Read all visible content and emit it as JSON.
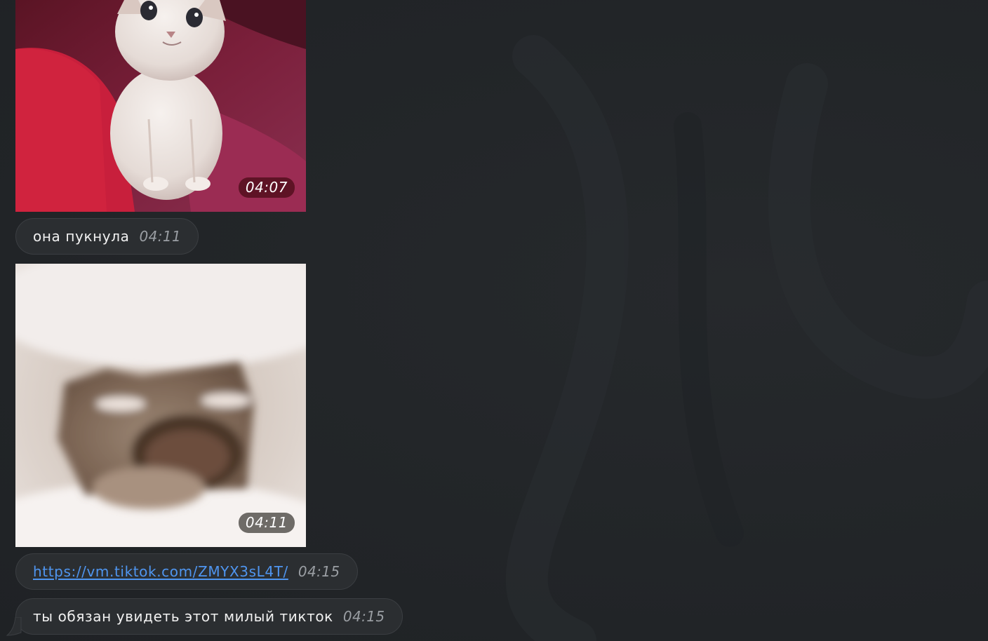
{
  "messages": [
    {
      "kind": "photo",
      "subject": "kitten",
      "time": "04:07"
    },
    {
      "kind": "text",
      "text": "она пукнула",
      "time": "04:11"
    },
    {
      "kind": "photo",
      "subject": "crying-cat-meme",
      "time": "04:11"
    },
    {
      "kind": "link",
      "text": "https://vm.tiktok.com/ZMYX3sL4T/",
      "time": "04:15"
    },
    {
      "kind": "text",
      "text": "ты обязан увидеть этот милый тикток",
      "time": "04:15"
    }
  ],
  "colors": {
    "background": "#222528",
    "bubble": "#2b2e31",
    "bubble_border": "#3b3e42",
    "text": "#f1f1f1",
    "time": "#9a9ea3",
    "link": "#4f95ef"
  }
}
